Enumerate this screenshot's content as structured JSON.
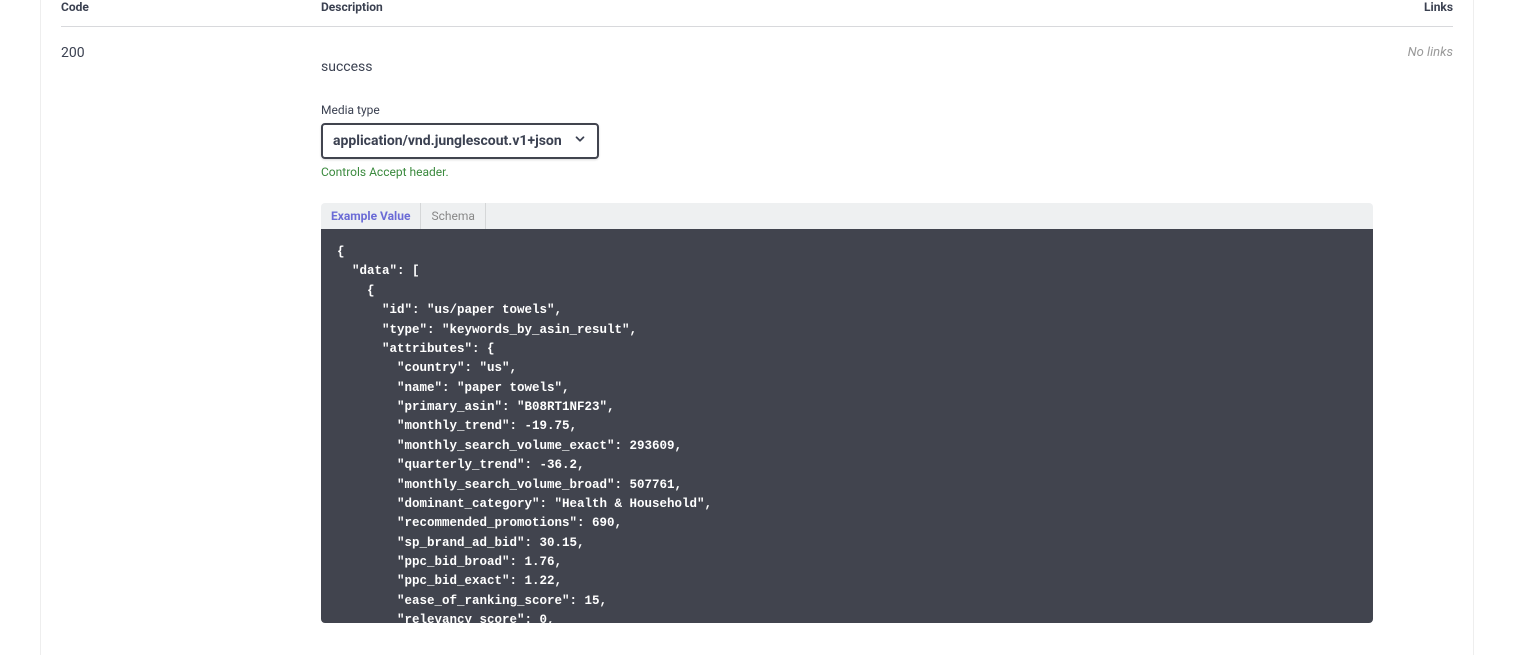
{
  "headers": {
    "code": "Code",
    "description": "Description",
    "links": "Links"
  },
  "response": {
    "code": "200",
    "description": "success",
    "links_text": "No links"
  },
  "media": {
    "label": "Media type",
    "selected": "application/vnd.junglescout.v1+json",
    "hint": "Controls Accept header."
  },
  "tabs": {
    "example": "Example Value",
    "schema": "Schema"
  },
  "example_json": "{\n  \"data\": [\n    {\n      \"id\": \"us/paper towels\",\n      \"type\": \"keywords_by_asin_result\",\n      \"attributes\": {\n        \"country\": \"us\",\n        \"name\": \"paper towels\",\n        \"primary_asin\": \"B08RT1NF23\",\n        \"monthly_trend\": -19.75,\n        \"monthly_search_volume_exact\": 293609,\n        \"quarterly_trend\": -36.2,\n        \"monthly_search_volume_broad\": 507761,\n        \"dominant_category\": \"Health & Household\",\n        \"recommended_promotions\": 690,\n        \"sp_brand_ad_bid\": 30.15,\n        \"ppc_bid_broad\": 1.76,\n        \"ppc_bid_exact\": 1.22,\n        \"ease_of_ranking_score\": 15,\n        \"relevancy_score\": 0,\n"
}
